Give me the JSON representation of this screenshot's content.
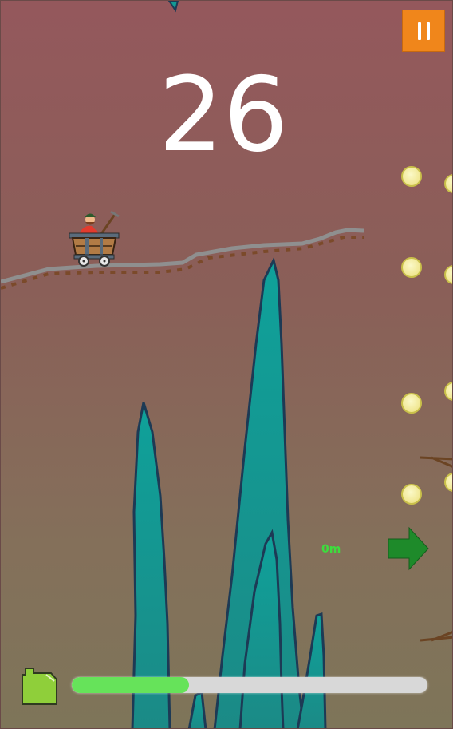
{
  "hud": {
    "score": "26",
    "distance": "0m",
    "fuel_fraction": 0.33
  },
  "icons": {
    "pause": "pause-icon",
    "fuel": "fuel-can-icon",
    "direction": "right-arrow-icon",
    "coin": "coin-icon",
    "player": "mine-cart-icon"
  },
  "colors": {
    "pause_button": "#f0861b",
    "crystal": "#129a93",
    "fuel_fill": "#66e35a",
    "coin": "#f4ef9a",
    "arrow": "#1e8a2a"
  }
}
